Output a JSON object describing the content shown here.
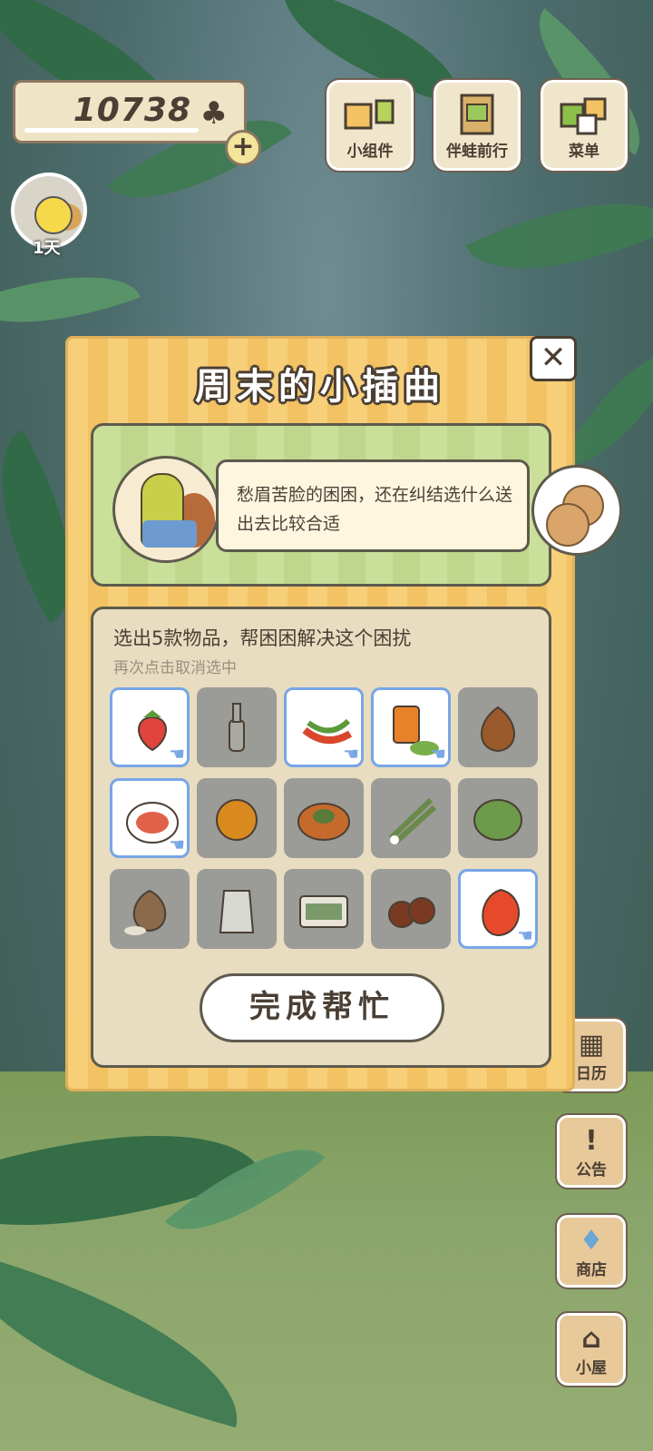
{
  "hud": {
    "coins": "10738",
    "days": "1天"
  },
  "top_buttons": [
    {
      "label": "小组件",
      "icon": "widget-icon"
    },
    {
      "label": "伴蛙前行",
      "icon": "book-icon"
    },
    {
      "label": "菜单",
      "icon": "menu-icon"
    }
  ],
  "side_buttons": [
    {
      "label": "日历",
      "icon": "calendar-icon"
    },
    {
      "label": "公告",
      "icon": "exclamation-icon"
    },
    {
      "label": "商店",
      "icon": "bag-icon"
    },
    {
      "label": "小屋",
      "icon": "house-icon"
    }
  ],
  "modal": {
    "title": "周末的小插曲",
    "story_text": "愁眉苦脸的困困，还在纠结选什么送出去比较合适",
    "instruction": "选出5款物品，帮困困解决这个困扰",
    "hint": "再次点击取消选中",
    "done_label": "完成帮忙",
    "items": [
      {
        "name": "strawberry",
        "selected": true,
        "color": "#e0443c"
      },
      {
        "name": "bottle",
        "selected": false,
        "color": "#a9a9a4"
      },
      {
        "name": "chili-peppers",
        "selected": true,
        "color": "#d9462a"
      },
      {
        "name": "canned-food",
        "selected": true,
        "color": "#e8822a"
      },
      {
        "name": "onion",
        "selected": false,
        "color": "#9a5a2c"
      },
      {
        "name": "salad-plate",
        "selected": true,
        "color": "#e0604a"
      },
      {
        "name": "orange",
        "selected": false,
        "color": "#d98a1e"
      },
      {
        "name": "pie",
        "selected": false,
        "color": "#c46a2c"
      },
      {
        "name": "green-onion",
        "selected": false,
        "color": "#6a8a4a"
      },
      {
        "name": "cabbage",
        "selected": false,
        "color": "#6a9a4a"
      },
      {
        "name": "rice-sack",
        "selected": false,
        "color": "#8a6a4a"
      },
      {
        "name": "milk-jug",
        "selected": false,
        "color": "#d8d8d2"
      },
      {
        "name": "bento-box",
        "selected": false,
        "color": "#7a9a6a"
      },
      {
        "name": "chestnuts",
        "selected": false,
        "color": "#7a3a22"
      },
      {
        "name": "mango",
        "selected": true,
        "color": "#e64a2a"
      }
    ]
  }
}
